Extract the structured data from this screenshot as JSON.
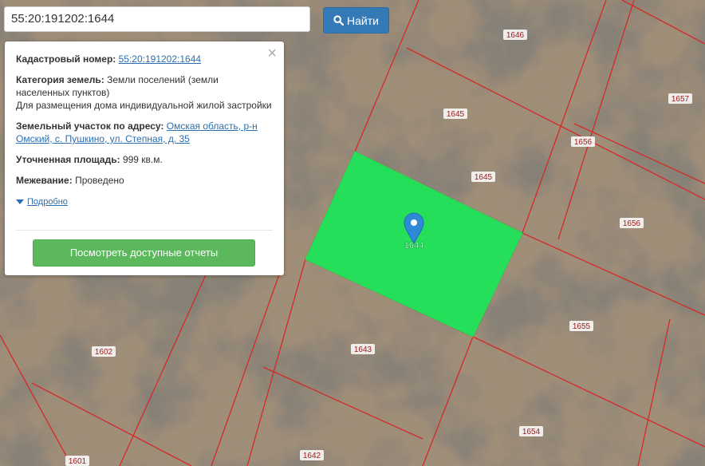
{
  "search": {
    "value": "55:20:191202:1644",
    "button_label": "Найти"
  },
  "info": {
    "cadastral_label": "Кадастровый номер:",
    "cadastral_value": "55:20:191202:1644",
    "category_label": "Категория земель:",
    "category_value": "Земли поселений (земли населенных пунктов)",
    "category_use": "Для размещения дома индивидуальной жилой застройки",
    "address_label": "Земельный участок по адресу:",
    "address_value": "Омская область, р-н Омский, с. Пушкино, ул. Степная, д. 35",
    "area_label": "Уточненная площадь:",
    "area_value": "999 кв.м.",
    "survey_label": "Межевание:",
    "survey_value": "Проведено",
    "details_link": "Подробно",
    "report_button": "Посмотреть доступные отчеты"
  },
  "map": {
    "selected_parcel": "1644",
    "parcel_labels": [
      "1646",
      "1645",
      "1657",
      "1656",
      "1645",
      "1656",
      "1655",
      "1643",
      "1602",
      "1654",
      "1642",
      "1601"
    ],
    "colors": {
      "parcel_fill": "#1fe357",
      "boundary": "#d42a2a",
      "label_text": "#9a1a1a",
      "marker": "#2f8ad6"
    }
  }
}
